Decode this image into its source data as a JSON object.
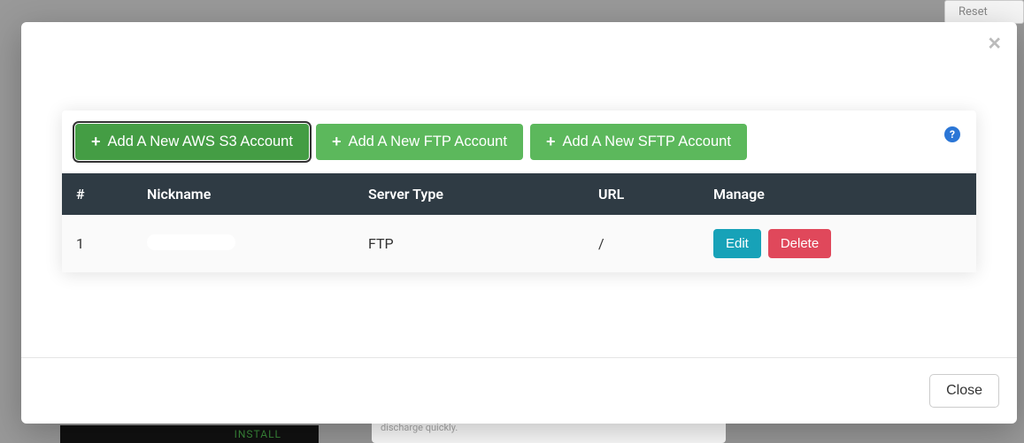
{
  "background": {
    "reset_button": "Reset",
    "install_text": "INSTALL",
    "card_text": "discharge quickly."
  },
  "modal": {
    "buttons": {
      "aws": "Add A New AWS S3 Account",
      "ftp": "Add A New FTP Account",
      "sftp": "Add A New SFTP Account"
    },
    "table": {
      "headers": {
        "num": "#",
        "nickname": "Nickname",
        "server_type": "Server Type",
        "url": "URL",
        "manage": "Manage"
      },
      "rows": [
        {
          "num": "1",
          "nickname": "",
          "server_type": "FTP",
          "url": "/",
          "edit": "Edit",
          "delete": "Delete"
        }
      ]
    },
    "help_label": "?",
    "footer": {
      "close": "Close"
    }
  }
}
